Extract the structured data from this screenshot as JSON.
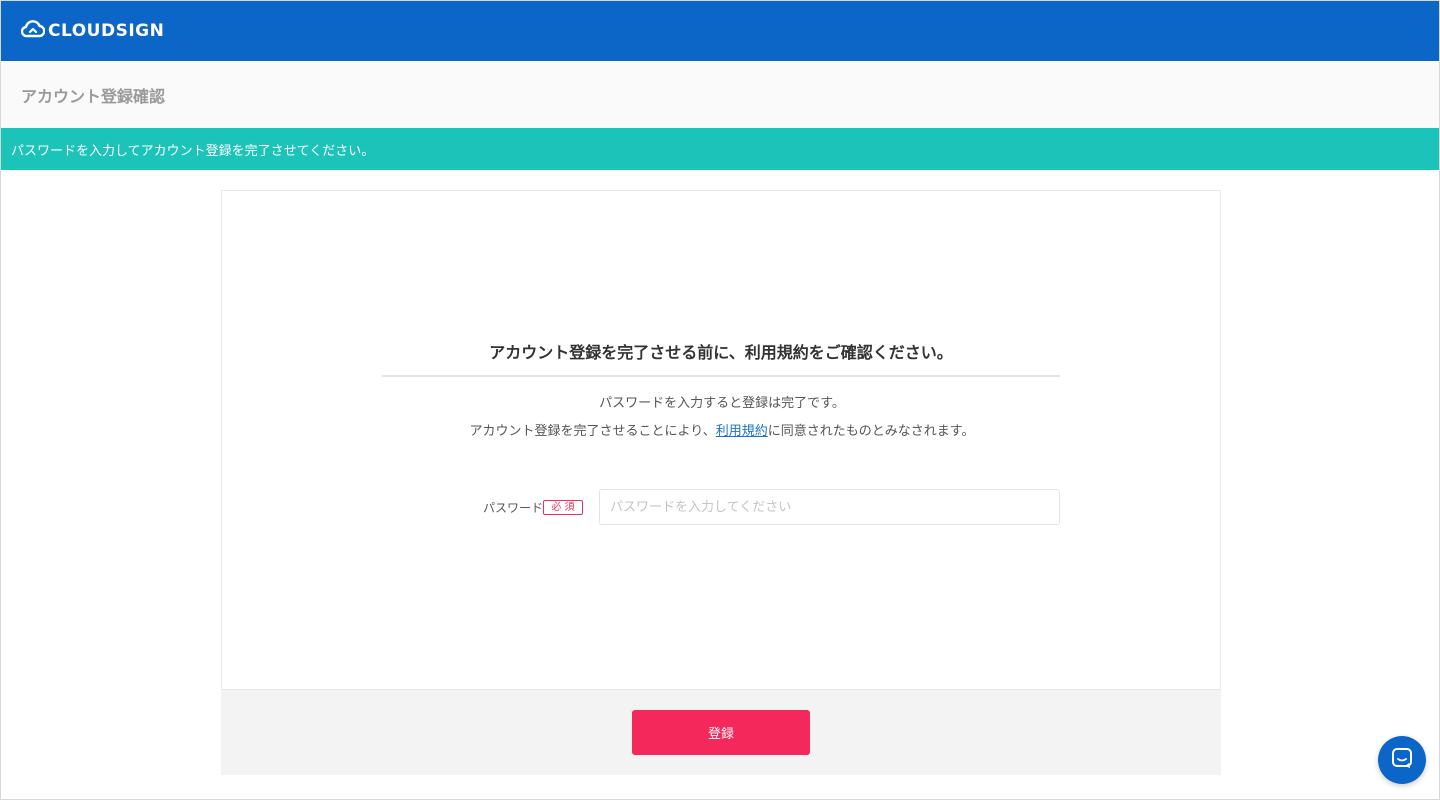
{
  "header": {
    "logo_text": "CLOUDSIGN",
    "logo_icon": "cloud-icon"
  },
  "page": {
    "title": "アカウント登録確認"
  },
  "notice": {
    "text": "パスワードを入力してアカウント登録を完了させてください。"
  },
  "card": {
    "heading": "アカウント登録を完了させる前に、利用規約をご確認ください。",
    "desc_line1": "パスワードを入力すると登録は完了です。",
    "desc_line2_prefix": "アカウント登録を完了させることにより、",
    "terms_link": "利用規約",
    "desc_line2_suffix": "に同意されたものとみなされます。",
    "password_label": "パスワード",
    "required_badge": "必 須",
    "password_placeholder": "パスワードを入力してください",
    "password_value": ""
  },
  "footer": {
    "submit_label": "登録"
  },
  "chat": {
    "icon": "chat-icon"
  },
  "colors": {
    "header_bg": "#0c66c8",
    "notice_bg": "#1cc3b8",
    "submit_bg": "#f4285a",
    "required": "#e8325a",
    "link": "#1a73c8"
  }
}
